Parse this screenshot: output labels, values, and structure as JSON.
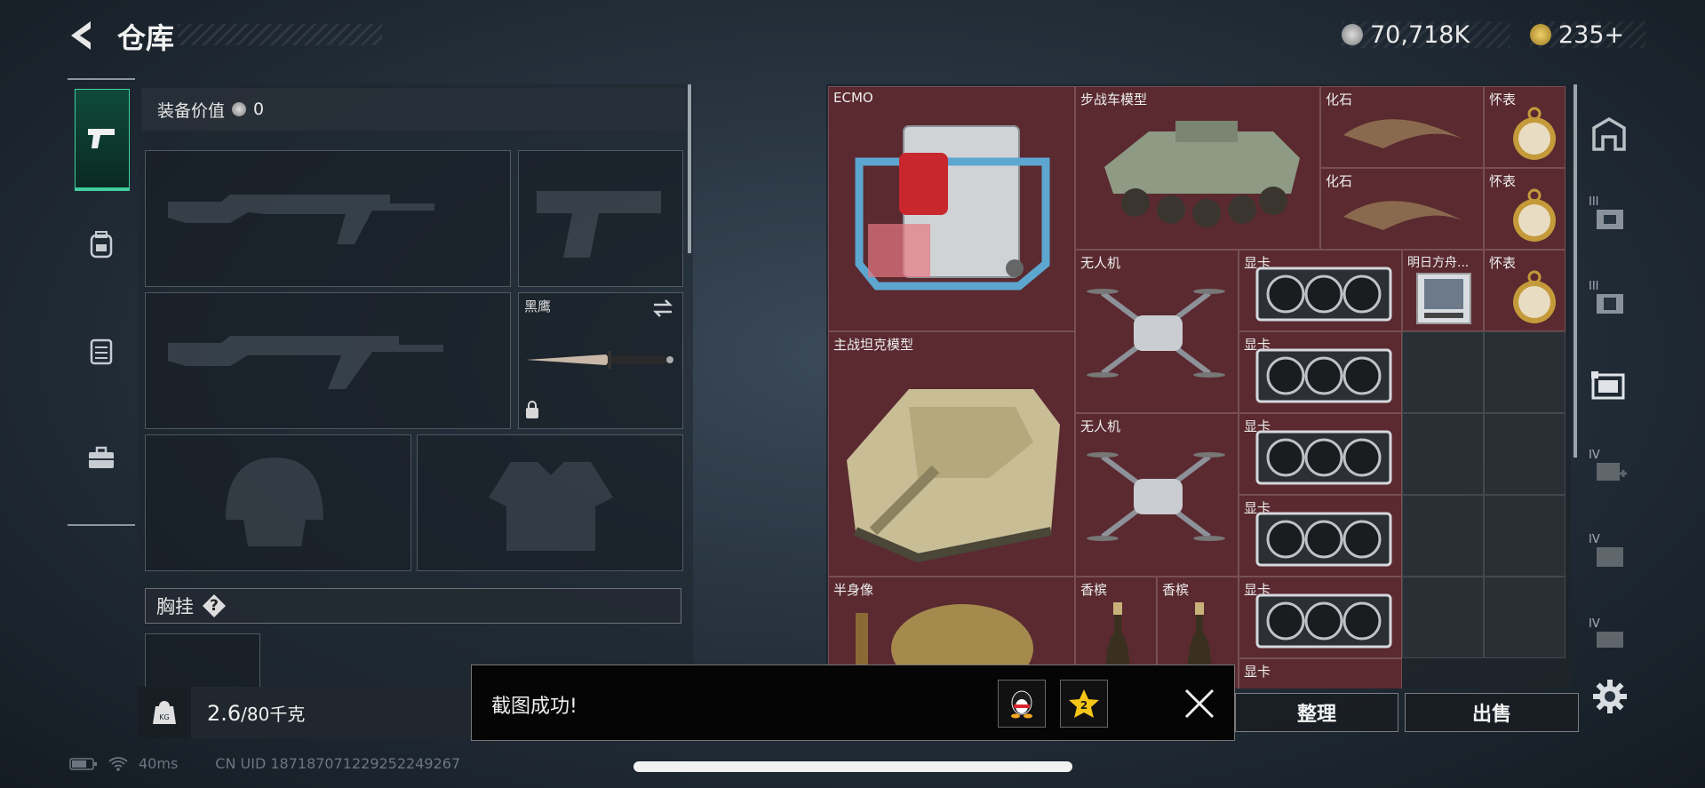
{
  "header": {
    "title": "仓库",
    "currency_silver": "70,718K",
    "currency_gold": "235+"
  },
  "left_nav": {
    "items": [
      {
        "name": "weapons",
        "icon": "pistol-icon",
        "active": true
      },
      {
        "name": "armor",
        "icon": "backpack-icon",
        "active": false
      },
      {
        "name": "vest",
        "icon": "vest-icon",
        "active": false
      },
      {
        "name": "tools",
        "icon": "toolbox-icon",
        "active": false
      }
    ]
  },
  "equipment": {
    "value_label": "装备价值",
    "value": "0",
    "melee_name": "黑鹰",
    "chest_rig_label": "胸挂",
    "help_symbol": "?"
  },
  "weight": {
    "current": "2.6",
    "max": "/80千克",
    "icon_label": "KG"
  },
  "storage": {
    "items": [
      {
        "id": "ecmo",
        "label": "ECMO"
      },
      {
        "id": "ifv",
        "label": "步战车模型"
      },
      {
        "id": "fossil1",
        "label": "化石"
      },
      {
        "id": "fossil2",
        "label": "化石"
      },
      {
        "id": "watch1",
        "label": "怀表"
      },
      {
        "id": "watch2",
        "label": "怀表"
      },
      {
        "id": "watch3",
        "label": "怀表"
      },
      {
        "id": "drone1",
        "label": "无人机"
      },
      {
        "id": "drone2",
        "label": "无人机"
      },
      {
        "id": "gpu1",
        "label": "显卡"
      },
      {
        "id": "gpu2",
        "label": "显卡"
      },
      {
        "id": "gpu3",
        "label": "显卡"
      },
      {
        "id": "gpu4",
        "label": "显卡"
      },
      {
        "id": "gpu5",
        "label": "显卡"
      },
      {
        "id": "gpu6",
        "label": "显卡"
      },
      {
        "id": "arknights",
        "label": "明日方舟..."
      },
      {
        "id": "tank",
        "label": "主战坦克模型"
      },
      {
        "id": "bust",
        "label": "半身像"
      },
      {
        "id": "champ1",
        "label": "香槟"
      },
      {
        "id": "champ2",
        "label": "香槟"
      }
    ]
  },
  "right_nav": {
    "items": [
      {
        "icon": "arch-icon",
        "roman": ""
      },
      {
        "icon": "vest-card-icon",
        "roman": "III"
      },
      {
        "icon": "armor-card-icon",
        "roman": "III"
      },
      {
        "icon": "cards-icon",
        "roman": ""
      },
      {
        "icon": "medkit-card-icon",
        "roman": "IV"
      },
      {
        "icon": "folder-card-icon",
        "roman": "IV"
      },
      {
        "icon": "case-card-icon",
        "roman": "IV"
      }
    ]
  },
  "buttons": {
    "sort": "整理",
    "sell": "出售"
  },
  "toast": {
    "message": "截图成功!"
  },
  "status": {
    "ping": "40ms",
    "uid": "CN UID 18718707122925224926​7"
  },
  "colors": {
    "item_bg": "#5a2a30",
    "accent": "#3fd0a0"
  }
}
